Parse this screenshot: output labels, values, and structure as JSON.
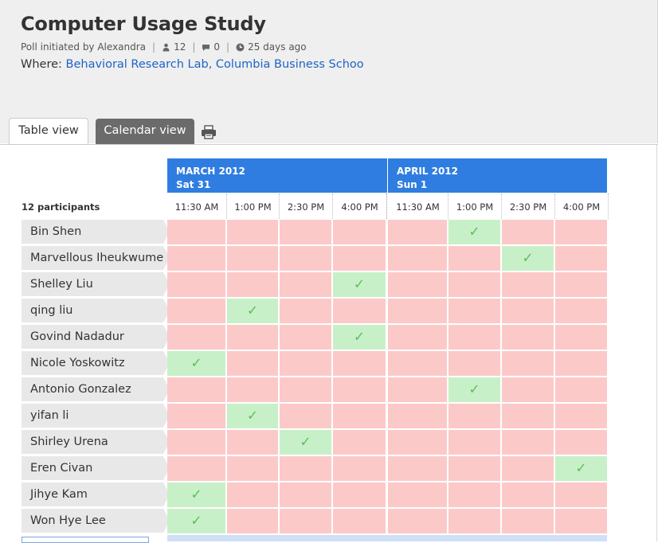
{
  "poll": {
    "title": "Computer Usage Study",
    "initiated": "Poll initiated by Alexandra",
    "participants_count": "12",
    "comments_count": "0",
    "age": "25 days ago",
    "where_label": "Where:",
    "where_value": "Behavioral Research Lab, Columbia Business Schoo"
  },
  "tabs": {
    "table": "Table view",
    "calendar": "Calendar view"
  },
  "grid": {
    "participants_label": "12 participants",
    "months": [
      {
        "month": "MARCH 2012",
        "day": "Sat 31"
      },
      {
        "month": "APRIL 2012",
        "day": "Sun 1"
      }
    ],
    "times": [
      "11:30 AM",
      "1:00 PM",
      "2:30 PM",
      "4:00 PM",
      "11:30 AM",
      "1:00 PM",
      "2:30 PM",
      "4:00 PM"
    ],
    "rows": [
      {
        "name": "Bin Shen",
        "yes": [
          5
        ]
      },
      {
        "name": "Marvellous Iheukwume",
        "yes": [
          6
        ]
      },
      {
        "name": "Shelley Liu",
        "yes": [
          3
        ]
      },
      {
        "name": "qing liu",
        "yes": [
          1
        ]
      },
      {
        "name": "Govind Nadadur",
        "yes": [
          3
        ]
      },
      {
        "name": "Nicole Yoskowitz",
        "yes": [
          0
        ]
      },
      {
        "name": "Antonio Gonzalez",
        "yes": [
          5
        ]
      },
      {
        "name": "yifan li",
        "yes": [
          1
        ]
      },
      {
        "name": "Shirley Urena",
        "yes": [
          2
        ]
      },
      {
        "name": "Eren Civan",
        "yes": [
          7
        ]
      },
      {
        "name": "Jihye Kam",
        "yes": [
          0
        ]
      },
      {
        "name": "Won Hye Lee",
        "yes": [
          0
        ]
      }
    ]
  },
  "colors": {
    "accent": "#2f7de1",
    "no": "#fcc9c9",
    "yes": "#c8f0c8",
    "check": "#5bbf5b",
    "link": "#1e63c6"
  }
}
